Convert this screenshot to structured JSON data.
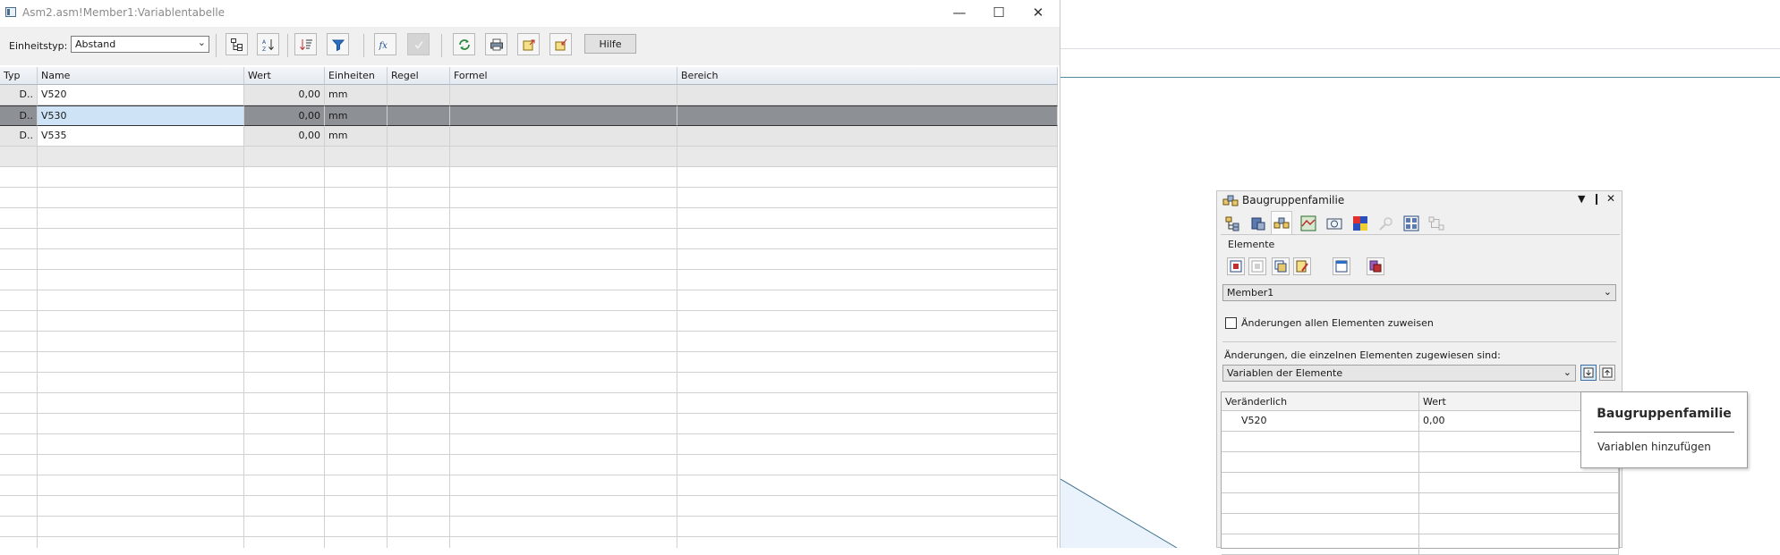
{
  "window": {
    "title": "Asm2.asm!Member1:Variablentabelle",
    "min_symbol": "—",
    "max_symbol": "☐",
    "close_symbol": "✕"
  },
  "toolbar": {
    "unit_label": "Einheitstyp:",
    "unit_value": "Abstand",
    "help_label": "Hilfe"
  },
  "table": {
    "headers": [
      "Typ",
      "Name",
      "Wert",
      "Einheiten",
      "Regel",
      "Formel",
      "Bereich"
    ],
    "rows": [
      {
        "typ": "D..",
        "name": "V520",
        "wert": "0,00",
        "einheiten": "mm",
        "regel": "",
        "formel": "",
        "bereich": ""
      },
      {
        "typ": "D..",
        "name": "V530",
        "wert": "0,00",
        "einheiten": "mm",
        "regel": "",
        "formel": "",
        "bereich": ""
      },
      {
        "typ": "D..",
        "name": "V535",
        "wert": "0,00",
        "einheiten": "mm",
        "regel": "",
        "formel": "",
        "bereich": ""
      }
    ]
  },
  "panel": {
    "title": "Baugruppenfamilie",
    "elements_label": "Elemente",
    "member_value": "Member1",
    "assign_all_label": "Änderungen allen Elementen zuweisen",
    "changes_label": "Änderungen, die einzelnen Elementen zugewiesen sind:",
    "changes_value": "Variablen der Elemente",
    "grid_headers": [
      "Veränderlich",
      "Wert"
    ],
    "grid_rows": [
      {
        "name": "V520",
        "value": "0,00"
      }
    ]
  },
  "tooltip": {
    "title": "Baugruppenfamilie",
    "text": "Variablen hinzufügen"
  },
  "colors": {
    "selected_row": "#8d9196",
    "selected_name_cell": "#cfe3f7",
    "accent_line": "#4f8a96",
    "readonly_cell": "#e6e6e6"
  }
}
